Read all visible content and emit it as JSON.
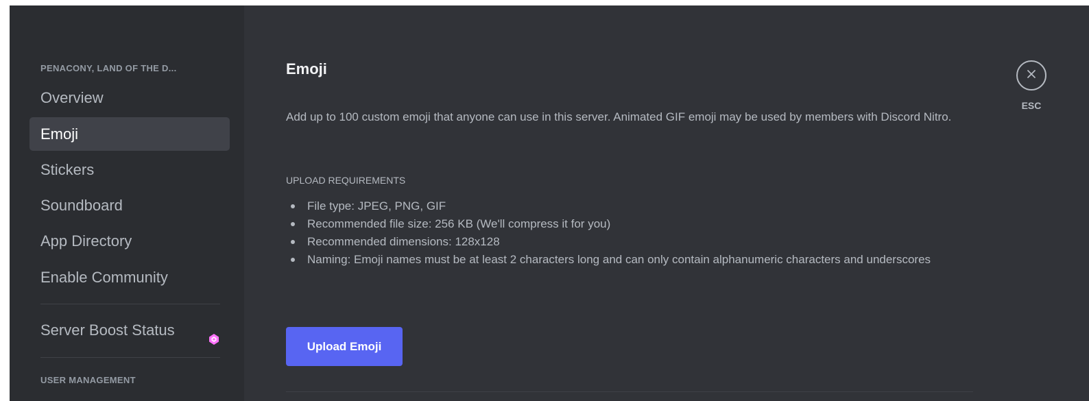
{
  "sidebar": {
    "server_header": "PENACONY, LAND OF THE D...",
    "items": [
      {
        "label": "Overview",
        "selected": false
      },
      {
        "label": "Emoji",
        "selected": true
      },
      {
        "label": "Stickers",
        "selected": false
      },
      {
        "label": "Soundboard",
        "selected": false
      },
      {
        "label": "App Directory",
        "selected": false
      },
      {
        "label": "Enable Community",
        "selected": false
      }
    ],
    "boost_item": {
      "label": "Server Boost Status",
      "icon": "boost-gem-icon",
      "icon_color": "#ff73fa"
    },
    "user_management_header": "USER MANAGEMENT"
  },
  "main": {
    "title": "Emoji",
    "description": "Add up to 100 custom emoji that anyone can use in this server. Animated GIF emoji may be used by members with Discord Nitro.",
    "requirements_header": "UPLOAD REQUIREMENTS",
    "requirements": [
      "File type: JPEG, PNG, GIF",
      "Recommended file size: 256 KB (We'll compress it for you)",
      "Recommended dimensions: 128x128",
      "Naming: Emoji names must be at least 2 characters long and can only contain alphanumeric characters and underscores"
    ],
    "upload_button_label": "Upload Emoji"
  },
  "close": {
    "icon": "close-icon",
    "label": "ESC"
  },
  "colors": {
    "sidebar_bg": "#2b2d31",
    "main_bg": "#313338",
    "selected_bg": "#404249",
    "accent": "#5865f2",
    "boost": "#ff73fa"
  }
}
